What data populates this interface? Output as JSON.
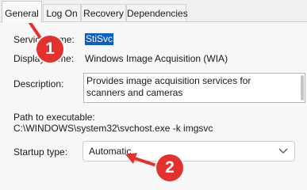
{
  "tabs": [
    {
      "label": "General",
      "active": true
    },
    {
      "label": "Log On",
      "active": false
    },
    {
      "label": "Recovery",
      "active": false
    },
    {
      "label": "Dependencies",
      "active": false
    }
  ],
  "general": {
    "service_name_label": "Service name:",
    "service_name_value": "StiSvc",
    "display_name_label": "Display name:",
    "display_name_value": "Windows Image Acquisition (WIA)",
    "description_label": "Description:",
    "description_value": "Provides image acquisition services for scanners and cameras",
    "path_label": "Path to executable:",
    "path_value": "C:\\WINDOWS\\system32\\svchost.exe -k imgsvc",
    "startup_type_label": "Startup type:",
    "startup_type_value": "Automatic"
  },
  "annotations": {
    "badge_1": "1",
    "badge_2": "2",
    "color": "#e3312e"
  }
}
